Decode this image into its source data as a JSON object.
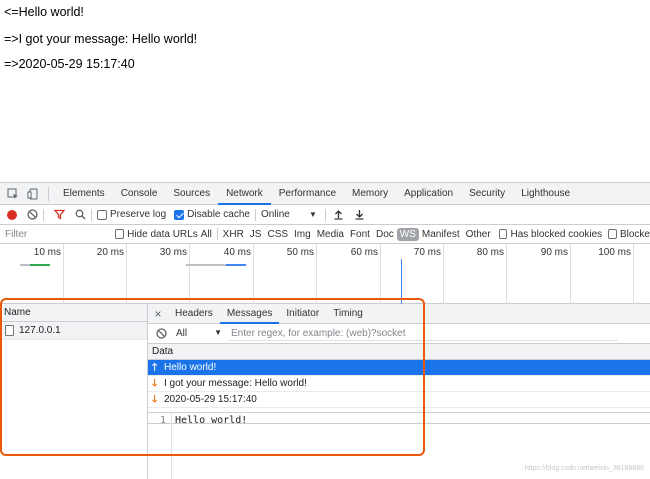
{
  "page_lines": [
    "<=Hello world!",
    "=>I got your message: Hello world!",
    "=>2020-05-29 15:17:40"
  ],
  "devtools": {
    "tabs": [
      "Elements",
      "Console",
      "Sources",
      "Network",
      "Performance",
      "Memory",
      "Application",
      "Security",
      "Lighthouse"
    ],
    "active_tab": "Network",
    "toolbar": {
      "preserve_log": "Preserve log",
      "disable_cache": "Disable cache",
      "throttle": "Online"
    },
    "filter": {
      "placeholder": "Filter",
      "hide_data_urls": "Hide data URLs",
      "types": [
        "All",
        "XHR",
        "JS",
        "CSS",
        "Img",
        "Media",
        "Font",
        "Doc",
        "WS",
        "Manifest",
        "Other"
      ],
      "active_type": "WS",
      "has_blocked_cookies": "Has blocked cookies",
      "blocked_requests": "Blocke"
    },
    "timeline": {
      "labels": [
        "10 ms",
        "20 ms",
        "30 ms",
        "40 ms",
        "50 ms",
        "60 ms",
        "70 ms",
        "80 ms",
        "90 ms",
        "100 ms"
      ]
    },
    "name_pane": {
      "header": "Name",
      "rows": [
        "127.0.0.1"
      ]
    },
    "detail": {
      "tabs": [
        "Headers",
        "Messages",
        "Initiator",
        "Timing"
      ],
      "active_tab": "Messages",
      "filter_select": "All",
      "regex_placeholder": "Enter regex, for example: (web)?socket",
      "data_header": "Data",
      "messages": [
        {
          "dir": "up",
          "text": "Hello world!",
          "selected": true
        },
        {
          "dir": "down",
          "text": "I got your message: Hello world!",
          "selected": false
        },
        {
          "dir": "down",
          "text": "2020-05-29 15:17:40",
          "selected": false
        }
      ],
      "preview": {
        "line_no": "1",
        "text": "Hello world!"
      }
    }
  },
  "watermark": "https://blog.csdn.net/weixin_38188888",
  "colors": {
    "accent": "#1a73e8",
    "highlight_box": "#e8590c",
    "record": "#d93025",
    "down_arrow": "#e8710a"
  }
}
